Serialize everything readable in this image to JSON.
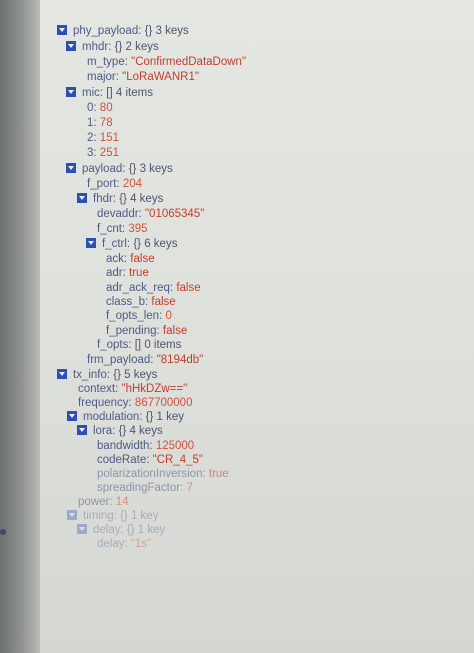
{
  "tree": {
    "phy_payload": {
      "label": "phy_payload:",
      "meta": "{} 3 keys"
    },
    "mhdr": {
      "label": "mhdr:",
      "meta": "{} 2 keys",
      "m_type": {
        "key": "m_type:",
        "value": "\"ConfirmedDataDown\""
      },
      "major": {
        "key": "major:",
        "value": "\"LoRaWANR1\""
      }
    },
    "mic": {
      "label": "mic:",
      "meta": "[] 4 items",
      "items": [
        {
          "key": "0:",
          "value": "80"
        },
        {
          "key": "1:",
          "value": "78"
        },
        {
          "key": "2:",
          "value": "151"
        },
        {
          "key": "3:",
          "value": "251"
        }
      ]
    },
    "payload": {
      "label": "payload:",
      "meta": "{} 3 keys",
      "f_port": {
        "key": "f_port:",
        "value": "204"
      }
    },
    "fhdr": {
      "label": "fhdr:",
      "meta": "{} 4 keys",
      "devaddr": {
        "key": "devaddr:",
        "value": "\"01065345\""
      },
      "f_cnt": {
        "key": "f_cnt:",
        "value": "395"
      }
    },
    "f_ctrl": {
      "label": "f_ctrl:",
      "meta": "{} 6 keys",
      "ack": {
        "key": "ack:",
        "value": "false"
      },
      "adr": {
        "key": "adr:",
        "value": "true"
      },
      "adr_ack_req": {
        "key": "adr_ack_req:",
        "value": "false"
      },
      "class_b": {
        "key": "class_b:",
        "value": "false"
      },
      "f_opts_len": {
        "key": "f_opts_len:",
        "value": "0"
      },
      "f_pending": {
        "key": "f_pending:",
        "value": "false"
      }
    },
    "f_opts": {
      "key": "f_opts:",
      "meta": "[] 0 items"
    },
    "frm_payload": {
      "key": "frm_payload:",
      "value": "\"8194db\""
    },
    "tx_info": {
      "label": "tx_info:",
      "meta": "{} 5 keys",
      "context": {
        "key": "context:",
        "value": "\"hHkDZw==\""
      },
      "frequency": {
        "key": "frequency:",
        "value": "867700000"
      }
    },
    "modulation": {
      "label": "modulation:",
      "meta": "{} 1 key"
    },
    "lora": {
      "label": "lora:",
      "meta": "{} 4 keys",
      "bandwidth": {
        "key": "bandwidth:",
        "value": "125000"
      },
      "code_rate": {
        "key": "codeRate:",
        "value": "\"CR_4_5\""
      },
      "polarization_inversion": {
        "key": "polarizationInversion:",
        "value": "true"
      },
      "spreading_factor": {
        "key": "spreadingFactor:",
        "value": "7"
      }
    },
    "power": {
      "key": "power:",
      "value": "14"
    },
    "timing": {
      "label": "timing:",
      "meta": "{} 1 key"
    },
    "delay": {
      "label": "delay:",
      "meta": "{} 1 key",
      "inner": {
        "key": "delay:",
        "value": "\"1s\""
      }
    }
  }
}
